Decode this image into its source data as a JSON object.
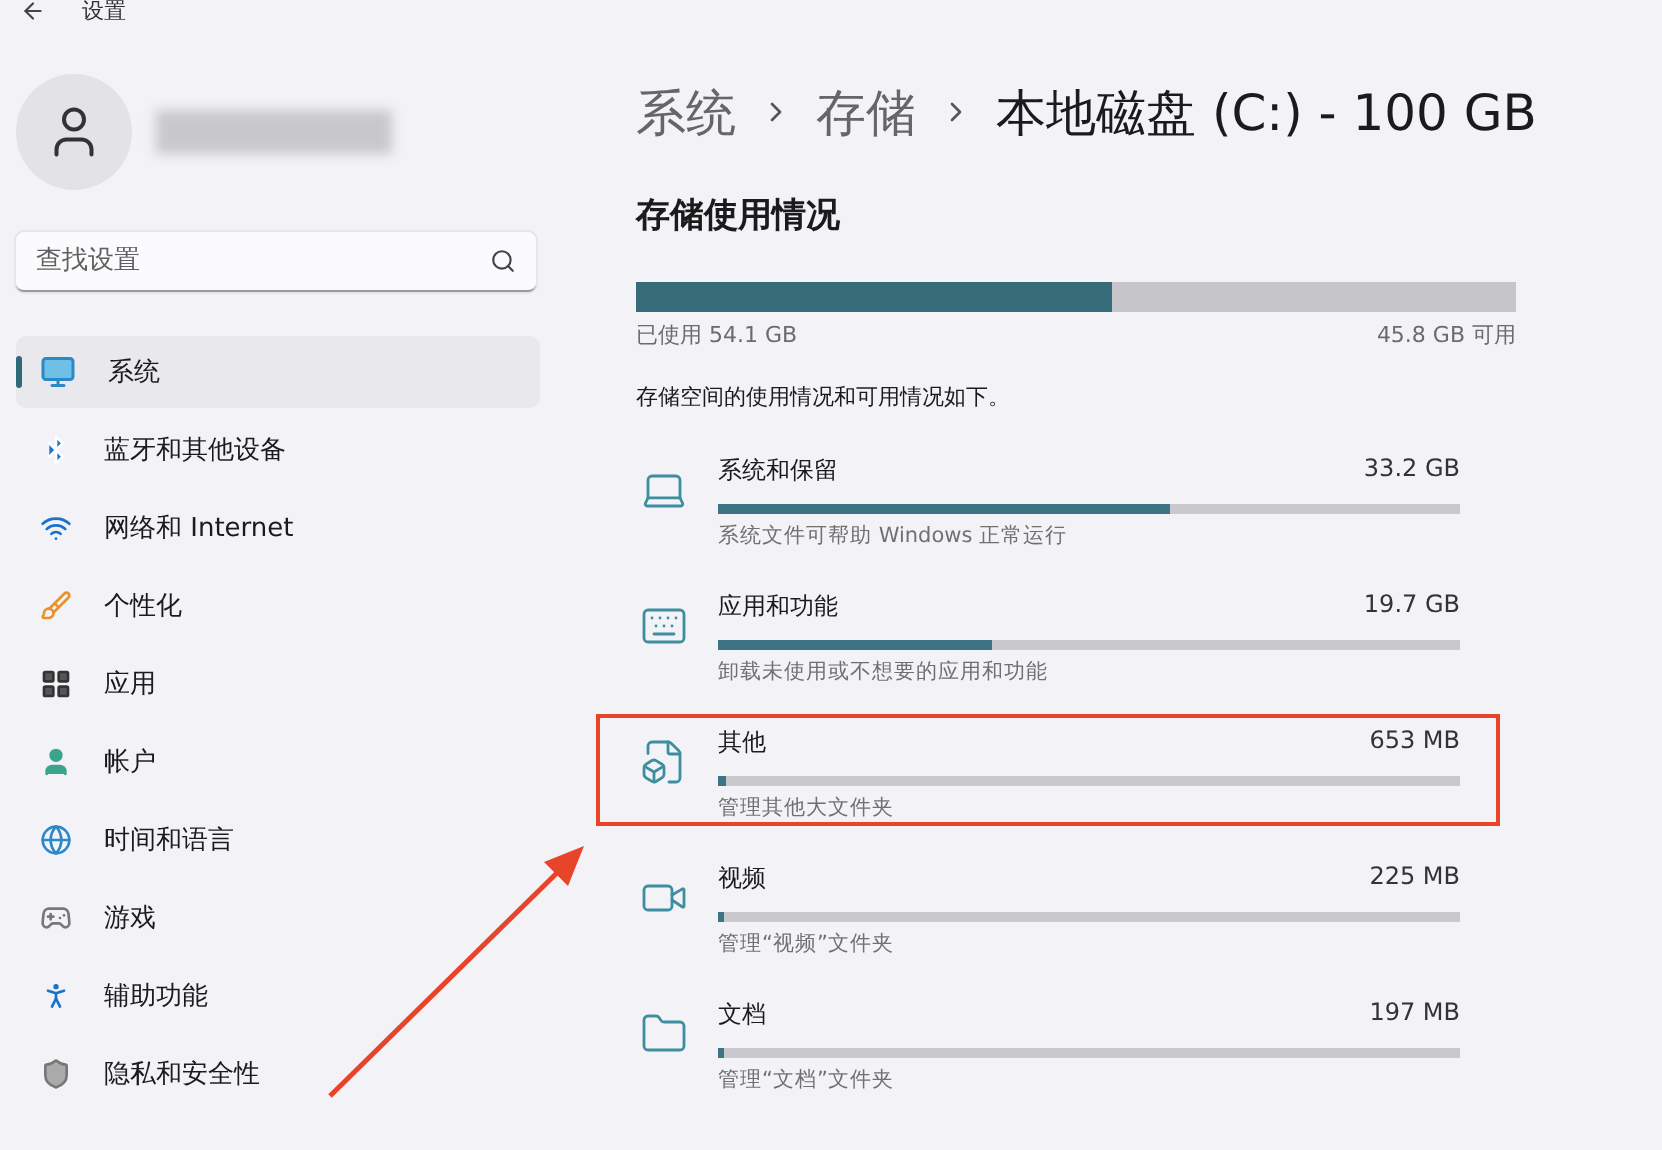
{
  "window": {
    "title": "设置"
  },
  "search": {
    "placeholder": "查找设置"
  },
  "nav": [
    {
      "label": "系统",
      "selected": true
    },
    {
      "label": "蓝牙和其他设备",
      "selected": false
    },
    {
      "label": "网络和 Internet",
      "selected": false
    },
    {
      "label": "个性化",
      "selected": false
    },
    {
      "label": "应用",
      "selected": false
    },
    {
      "label": "帐户",
      "selected": false
    },
    {
      "label": "时间和语言",
      "selected": false
    },
    {
      "label": "游戏",
      "selected": false
    },
    {
      "label": "辅助功能",
      "selected": false
    },
    {
      "label": "隐私和安全性",
      "selected": false
    }
  ],
  "breadcrumb": [
    "系统",
    "存储",
    "本地磁盘 (C:) - 100 GB"
  ],
  "usage": {
    "title": "存储使用情况",
    "level": 0.54,
    "used": "已使用 54.1 GB",
    "free": "45.8 GB 可用",
    "description": "存储空间的使用情况和可用情况如下。"
  },
  "items": [
    {
      "name": "系统和保留",
      "size": "33.2 GB",
      "level": 0.61,
      "description": "系统文件可帮助 Windows 正常运行",
      "highlighted": false
    },
    {
      "name": "应用和功能",
      "size": "19.7 GB",
      "level": 0.37,
      "description": "卸载未使用或不想要的应用和功能",
      "highlighted": false
    },
    {
      "name": "其他",
      "size": "653 MB",
      "level": 0.01,
      "description": "管理其他大文件夹",
      "highlighted": true
    },
    {
      "name": "视频",
      "size": "225 MB",
      "level": 0.005,
      "description": "管理“视频”文件夹",
      "highlighted": false
    },
    {
      "name": "文档",
      "size": "197 MB",
      "level": 0.004,
      "description": "管理“文档”文件夹",
      "highlighted": false
    }
  ]
}
